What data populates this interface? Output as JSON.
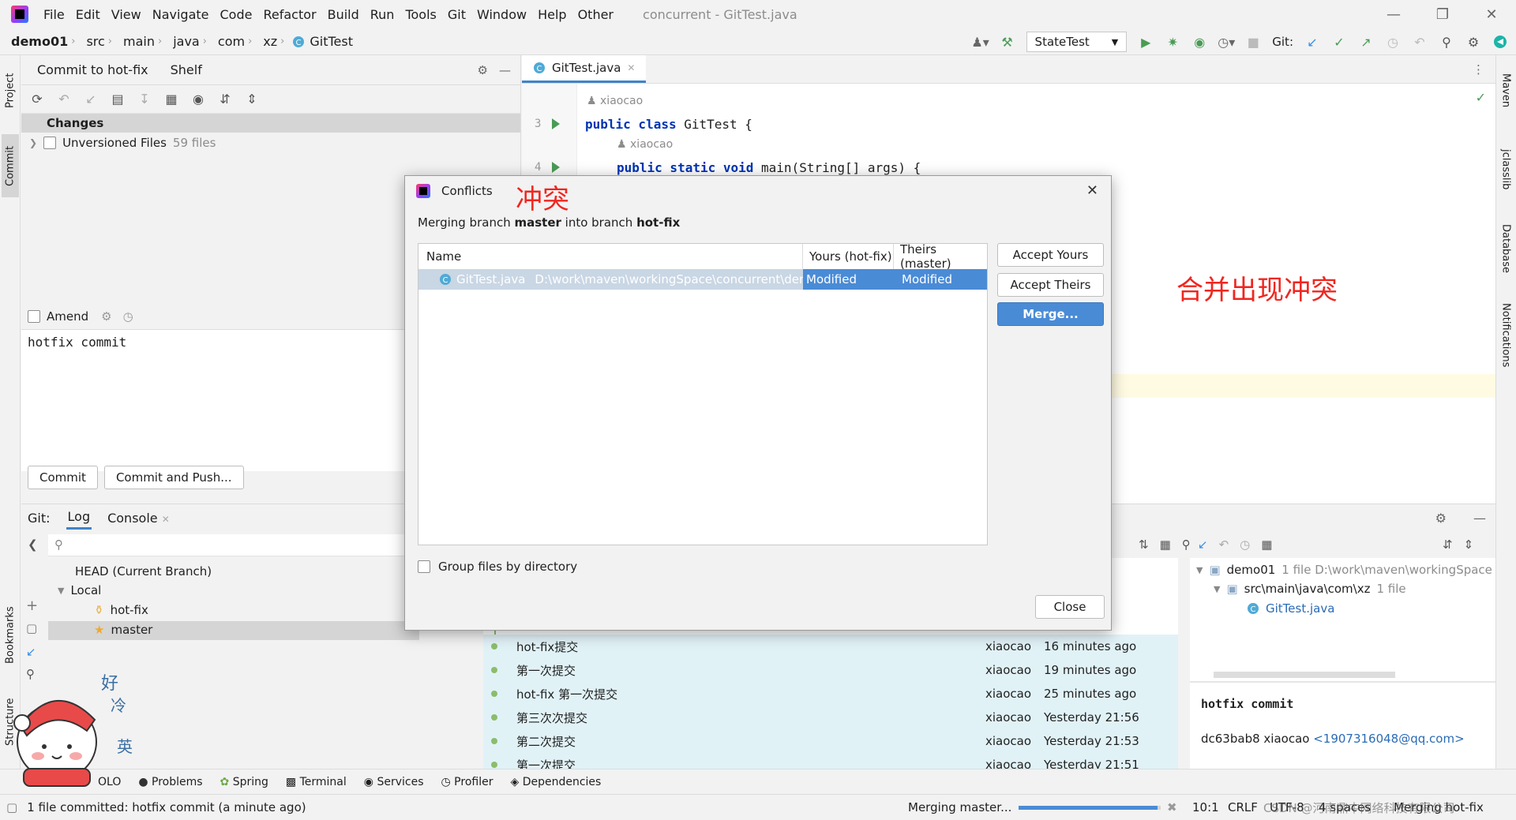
{
  "menubar": {
    "items": [
      "File",
      "Edit",
      "View",
      "Navigate",
      "Code",
      "Refactor",
      "Build",
      "Run",
      "Tools",
      "Git",
      "Window",
      "Help",
      "Other"
    ],
    "window_title": "concurrent - GitTest.java"
  },
  "navbar": {
    "crumbs": [
      "demo01",
      "src",
      "main",
      "java",
      "com",
      "xz",
      "GitTest"
    ],
    "run_config": "StateTest",
    "git_label": "Git:"
  },
  "left_strip": {
    "project": "Project",
    "commit": "Commit",
    "bookmarks": "Bookmarks",
    "structure": "Structure"
  },
  "right_strip": {
    "maven": "Maven",
    "jclasslib": "jclasslib",
    "database": "Database",
    "notifications": "Notifications"
  },
  "commit_panel": {
    "tab_commit": "Commit to hot-fix",
    "tab_shelf": "Shelf",
    "changes_header": "Changes",
    "unversioned_label": "Unversioned Files",
    "unversioned_count": "59 files",
    "amend_label": "Amend",
    "message": "hotfix commit",
    "commit_button": "Commit",
    "commit_push_button": "Commit and Push..."
  },
  "editor": {
    "tab": "GitTest.java",
    "author1": "xiaocao",
    "line3_num": "3",
    "line3_kw": "public class",
    "line3_rest": " GitTest {",
    "author2": "xiaocao",
    "line4_num": "4",
    "line4_kw": "public static void",
    "line4_rest": " main(String[] args) {",
    "annotation_conflict": "冲突",
    "annotation_merge": "合并出现冲突"
  },
  "git_panel": {
    "label": "Git:",
    "tab_log": "Log",
    "tab_console": "Console",
    "head": "HEAD (Current Branch)",
    "local": "Local",
    "branch_hotfix": "hot-fix",
    "branch_master": "master",
    "log_rows": [
      {
        "msg": "hot-fix提交",
        "author": "xiaocao",
        "date": "16 minutes ago"
      },
      {
        "msg": "第一次提交",
        "author": "xiaocao",
        "date": "19 minutes ago"
      },
      {
        "msg": "hot-fix 第一次提交",
        "author": "xiaocao",
        "date": "25 minutes ago"
      },
      {
        "msg": "第三次次提交",
        "author": "xiaocao",
        "date": "Yesterday 21:56"
      },
      {
        "msg": "第二次提交",
        "author": "xiaocao",
        "date": "Yesterday 21:53"
      },
      {
        "msg": "第一次提交",
        "author": "xiaocao",
        "date": "Yesterday 21:51"
      }
    ],
    "partial_dates": [
      "go",
      "go",
      "ago"
    ],
    "details_root": "demo01",
    "details_root_meta": "1 file  D:\\work\\maven\\workingSpace",
    "details_dir": "src\\main\\java\\com\\xz",
    "details_dir_meta": "1 file",
    "details_file": "GitTest.java",
    "commit_msg": "hotfix commit",
    "commit_hash_author": "dc63bab8 xiaocao",
    "commit_email": "<1907316048@qq.com>"
  },
  "toolstrip": [
    "Problems",
    "Spring",
    "Terminal",
    "Services",
    "Profiler",
    "Dependencies"
  ],
  "toolstrip_partial": "OLO",
  "statusbar": {
    "message": "1 file committed: hotfix commit (a minute ago)",
    "progress_label": "Merging master...",
    "progress": 0.98,
    "position": "10:1",
    "line_sep": "CRLF",
    "encoding": "UTF-8",
    "indent": "4 spaces",
    "branch": "Merging hot-fix",
    "watermark": "CSDN @河南鼎中网络科技有限公司"
  },
  "dialog": {
    "title": "Conflicts",
    "subtitle_pre": "Merging branch ",
    "subtitle_branch1": "master",
    "subtitle_mid": " into branch ",
    "subtitle_branch2": "hot-fix",
    "col_name": "Name",
    "col_yours": "Yours (hot-fix)",
    "col_theirs": "Theirs (master)",
    "row_file": "GitTest.java",
    "row_path": "D:\\work\\maven\\workingSpace\\concurrent\\dem",
    "row_yours": "Modified",
    "row_theirs": "Modified",
    "accept_yours": "Accept Yours",
    "accept_theirs": "Accept Theirs",
    "merge": "Merge...",
    "group_label": "Group files by directory",
    "close": "Close"
  },
  "sticker": {
    "text1": "好",
    "text2": "冷",
    "text3": "英"
  },
  "colors": {
    "accent": "#4a8bd6",
    "selection": "#4a8bd6",
    "log_bg": "#e1f2f7",
    "annotation": "#f0261f",
    "run_green": "#499c54"
  }
}
